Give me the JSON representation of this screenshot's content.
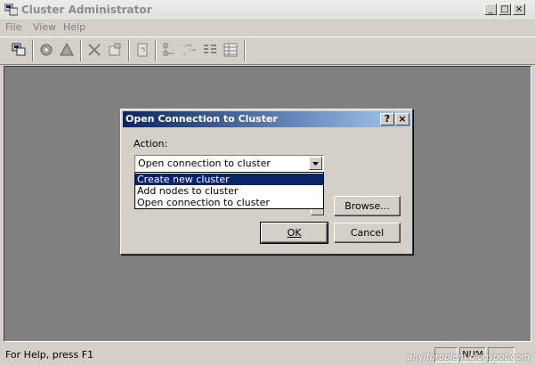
{
  "window": {
    "title": "Cluster Administrator",
    "controls": [
      "_",
      "□",
      "×"
    ]
  },
  "menu": [
    {
      "label": "File"
    },
    {
      "label": "View"
    },
    {
      "label": "Help"
    }
  ],
  "toolbar": {
    "icons": [
      "cluster-open-icon",
      "properties-icon",
      "warning-icon",
      "delete-icon",
      "network-icon",
      "refresh-icon",
      "large-icons-icon",
      "small-icons-icon",
      "list-view-icon",
      "details-view-icon"
    ]
  },
  "status": {
    "text": "For Help, press F1",
    "num": "NUM"
  },
  "watermark": "anyitproblem.blogspot.com",
  "dialog": {
    "title": "Open Connection to Cluster",
    "help_glyph": "?",
    "close_glyph": "×",
    "action_label": "Action:",
    "combo_value": "Open connection to cluster",
    "options": [
      "Create new cluster",
      "Add nodes to cluster",
      "Open connection to cluster"
    ],
    "selected_index": 0,
    "browse_label": "Browse...",
    "ok_label": "OK",
    "cancel_label": "Cancel"
  }
}
